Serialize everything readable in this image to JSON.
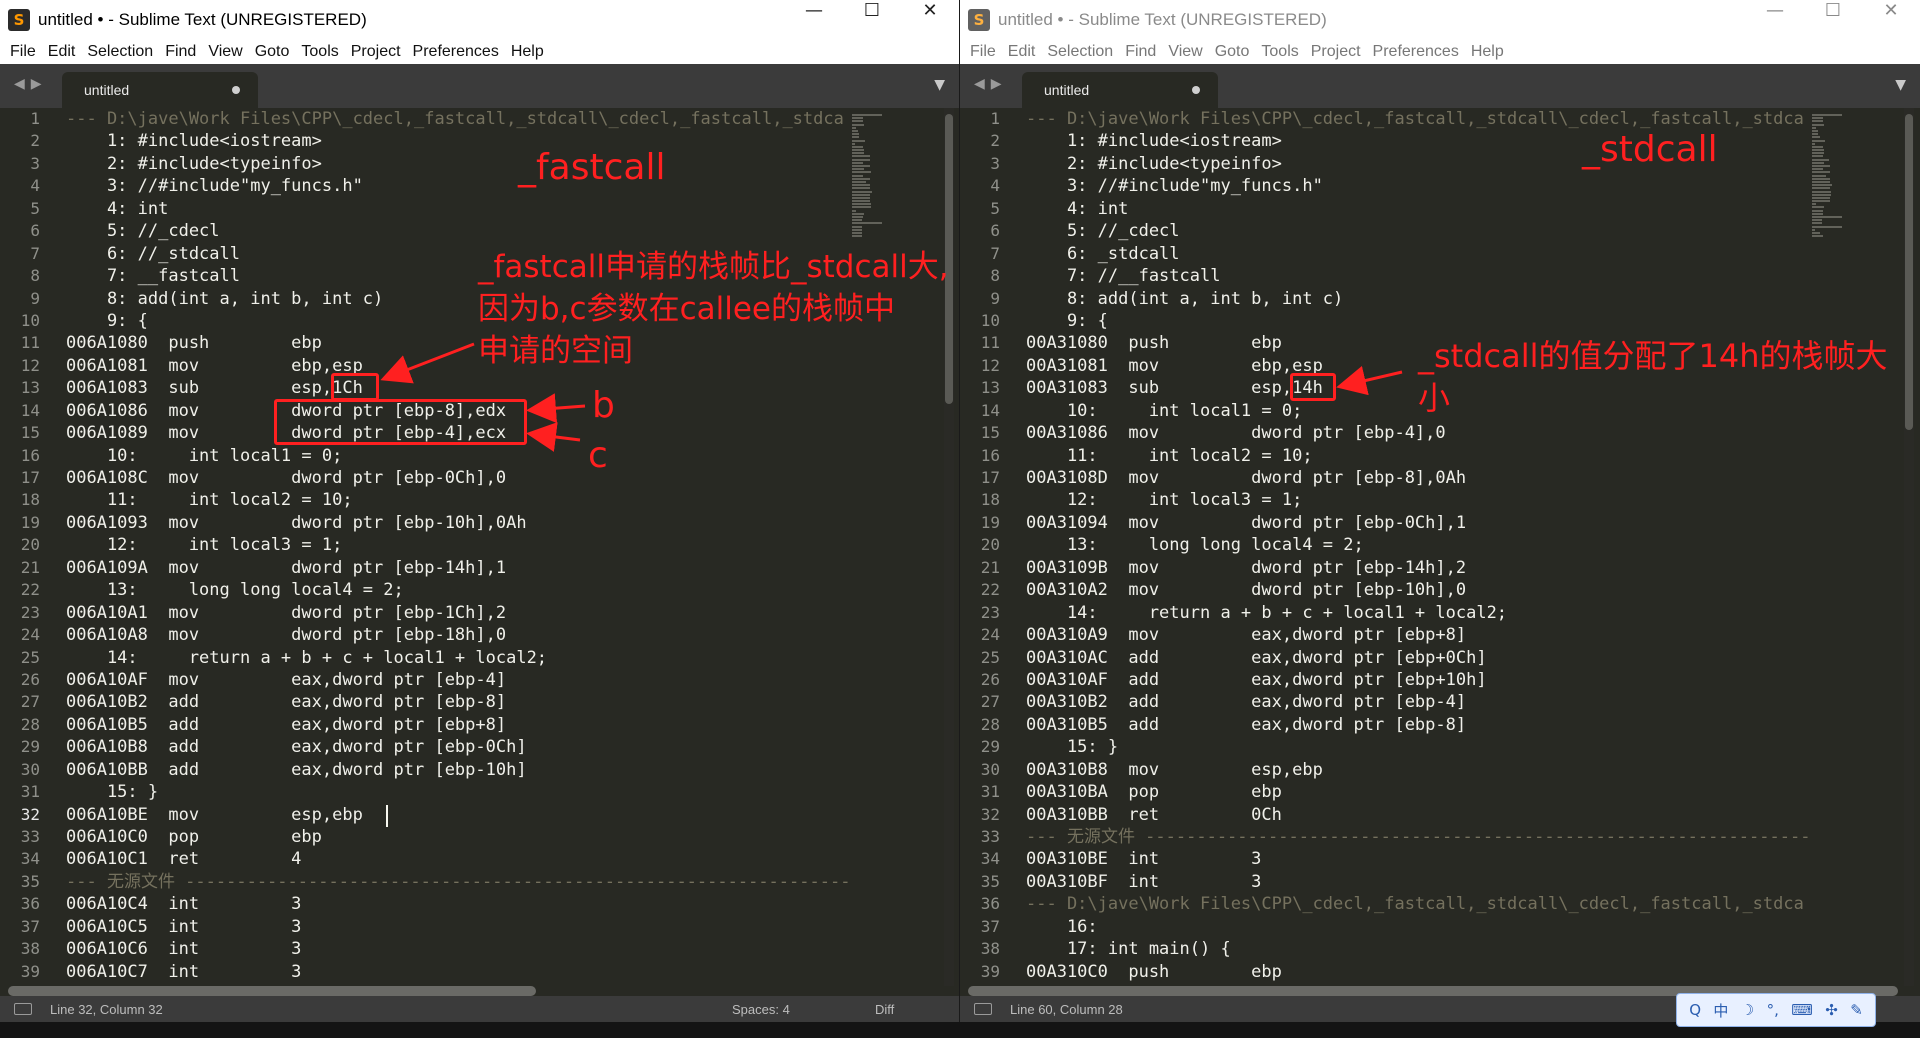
{
  "left_window": {
    "title": "untitled • - Sublime Text (UNREGISTERED)",
    "tab_label": "untitled",
    "status": {
      "position": "Line 32, Column 32",
      "spaces": "Spaces: 4",
      "syntax": "Diff"
    },
    "active_line_index": 31,
    "caret_line_index": 31,
    "lines": [
      "--- D:\\jave\\Work Files\\CPP\\_cdecl,_fastcall,_stdcall\\_cdecl,_fastcall,_stdca",
      "    1: #include<iostream>",
      "    2: #include<typeinfo>",
      "    3: //#include\"my_funcs.h\"",
      "    4: int",
      "    5: //_cdecl",
      "    6: //_stdcall",
      "    7: __fastcall",
      "    8: add(int a, int b, int c)",
      "    9: {",
      "006A1080  push        ebp",
      "006A1081  mov         ebp,esp",
      "006A1083  sub         esp,1Ch",
      "006A1086  mov         dword ptr [ebp-8],edx",
      "006A1089  mov         dword ptr [ebp-4],ecx",
      "    10:     int local1 = 0;",
      "006A108C  mov         dword ptr [ebp-0Ch],0",
      "    11:     int local2 = 10;",
      "006A1093  mov         dword ptr [ebp-10h],0Ah",
      "    12:     int local3 = 1;",
      "006A109A  mov         dword ptr [ebp-14h],1",
      "    13:     long long local4 = 2;",
      "006A10A1  mov         dword ptr [ebp-1Ch],2",
      "006A10A8  mov         dword ptr [ebp-18h],0",
      "    14:     return a + b + c + local1 + local2;",
      "006A10AF  mov         eax,dword ptr [ebp-4]",
      "006A10B2  add         eax,dword ptr [ebp-8]",
      "006A10B5  add         eax,dword ptr [ebp+8]",
      "006A10B8  add         eax,dword ptr [ebp-0Ch]",
      "006A10BB  add         eax,dword ptr [ebp-10h]",
      "    15: }",
      "006A10BE  mov         esp,ebp",
      "006A10C0  pop         ebp",
      "006A10C1  ret         4",
      "--- 无源文件 -----------------------------------------------------------------------",
      "006A10C4  int         3",
      "006A10C5  int         3",
      "006A10C6  int         3",
      "006A10C7  int         3"
    ],
    "annotations": {
      "title": "_fastcall",
      "note": "_fastcall申请的栈帧比_stdcall大,\n因为b,c参数在callee的栈帧中\n申请的空间",
      "label_b": "b",
      "label_c": "c"
    }
  },
  "right_window": {
    "title": "untitled • - Sublime Text (UNREGISTERED)",
    "tab_label": "untitled",
    "status": {
      "position": "Line 60, Column 28"
    },
    "lines": [
      "--- D:\\jave\\Work Files\\CPP\\_cdecl,_fastcall,_stdcall\\_cdecl,_fastcall,_stdca",
      "    1: #include<iostream>",
      "    2: #include<typeinfo>",
      "    3: //#include\"my_funcs.h\"",
      "    4: int",
      "    5: //_cdecl",
      "    6: _stdcall",
      "    7: //__fastcall",
      "    8: add(int a, int b, int c)",
      "    9: {",
      "00A31080  push        ebp",
      "00A31081  mov         ebp,esp",
      "00A31083  sub         esp,14h",
      "    10:     int local1 = 0;",
      "00A31086  mov         dword ptr [ebp-4],0",
      "    11:     int local2 = 10;",
      "00A3108D  mov         dword ptr [ebp-8],0Ah",
      "    12:     int local3 = 1;",
      "00A31094  mov         dword ptr [ebp-0Ch],1",
      "    13:     long long local4 = 2;",
      "00A3109B  mov         dword ptr [ebp-14h],2",
      "00A310A2  mov         dword ptr [ebp-10h],0",
      "    14:     return a + b + c + local1 + local2;",
      "00A310A9  mov         eax,dword ptr [ebp+8]",
      "00A310AC  add         eax,dword ptr [ebp+0Ch]",
      "00A310AF  add         eax,dword ptr [ebp+10h]",
      "00A310B2  add         eax,dword ptr [ebp-4]",
      "00A310B5  add         eax,dword ptr [ebp-8]",
      "    15: }",
      "00A310B8  mov         esp,ebp",
      "00A310BA  pop         ebp",
      "00A310BB  ret         0Ch",
      "--- 无源文件 -----------------------------------------------------------------------",
      "00A310BE  int         3",
      "00A310BF  int         3",
      "--- D:\\jave\\Work Files\\CPP\\_cdecl,_fastcall,_stdcall\\_cdecl,_fastcall,_stdca",
      "    16:",
      "    17: int main() {",
      "00A310C0  push        ebp"
    ],
    "annotations": {
      "title": "_stdcall",
      "note": "_stdcall的值分配了14h的栈帧大\n小"
    }
  },
  "menu": [
    "File",
    "Edit",
    "Selection",
    "Find",
    "View",
    "Goto",
    "Tools",
    "Project",
    "Preferences",
    "Help"
  ],
  "window_controls": {
    "minimize": "—",
    "maximize": "☐",
    "close": "✕"
  },
  "icons": {
    "app": "sublime-logo-icon",
    "tab_dirty": "dot-icon",
    "nav": "arrow-left-right-icon",
    "tab_menu": "chevron-down-icon",
    "status": "console-icon"
  },
  "ime_toolbar": [
    "Q",
    "中",
    "☽",
    "°,",
    "⌨",
    "✣",
    "✎"
  ],
  "colors": {
    "annotation": "#ff2020",
    "editor_bg": "#282923",
    "tabbar_bg": "#3b3b3b"
  }
}
